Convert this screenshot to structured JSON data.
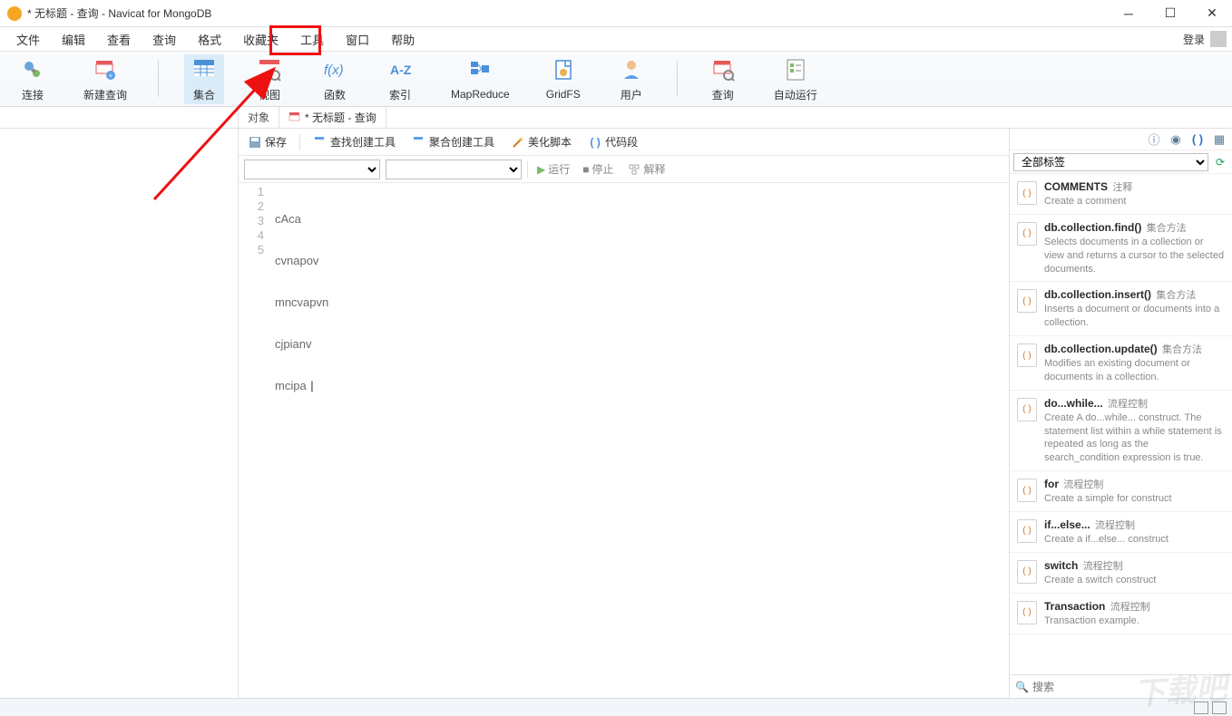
{
  "title": "* 无标题 - 查询 - Navicat for MongoDB",
  "menu": {
    "items": [
      "文件",
      "编辑",
      "查看",
      "查询",
      "格式",
      "收藏夹",
      "工具",
      "窗口",
      "帮助"
    ],
    "login": "登录"
  },
  "toolbar": [
    {
      "id": "connect",
      "label": "连接"
    },
    {
      "id": "newquery",
      "label": "新建查询"
    },
    {
      "id": "collection",
      "label": "集合",
      "active": true
    },
    {
      "id": "view",
      "label": "视图"
    },
    {
      "id": "function",
      "label": "函数"
    },
    {
      "id": "index",
      "label": "索引"
    },
    {
      "id": "mapreduce",
      "label": "MapReduce"
    },
    {
      "id": "gridfs",
      "label": "GridFS"
    },
    {
      "id": "user",
      "label": "用户"
    },
    {
      "id": "query",
      "label": "查询"
    },
    {
      "id": "autorun",
      "label": "自动运行"
    }
  ],
  "tabs": {
    "object": "对象",
    "doc": "* 无标题 - 查询"
  },
  "subtoolbar": {
    "save": "保存",
    "findbuilder": "查找创建工具",
    "aggbuilder": "聚合创建工具",
    "beautify": "美化脚本",
    "snippet": "代码段"
  },
  "querybar": {
    "run": "运行",
    "stop": "停止",
    "explain": "解释"
  },
  "editor": {
    "lines": [
      "cAca",
      "cvnapov",
      "mncvapvn",
      "cjpianv",
      "mcipa "
    ]
  },
  "rightpane": {
    "filter_label": "全部标签",
    "search_placeholder": "搜索",
    "snippets": [
      {
        "title": "COMMENTS",
        "tag": "注释",
        "desc": "Create a comment"
      },
      {
        "title": "db.collection.find()",
        "tag": "集合方法",
        "desc": "Selects documents in a collection or view and returns a cursor to the selected documents."
      },
      {
        "title": "db.collection.insert()",
        "tag": "集合方法",
        "desc": "Inserts a document or documents into a collection."
      },
      {
        "title": "db.collection.update()",
        "tag": "集合方法",
        "desc": "Modifies an existing document or documents in a collection."
      },
      {
        "title": "do...while...",
        "tag": "流程控制",
        "desc": "Create A do...while... construct. The statement list within a while statement is repeated as long as the search_condition expression is true."
      },
      {
        "title": "for",
        "tag": "流程控制",
        "desc": "Create a simple for construct"
      },
      {
        "title": "if...else...",
        "tag": "流程控制",
        "desc": "Create a if...else... construct"
      },
      {
        "title": "switch",
        "tag": "流程控制",
        "desc": "Create a switch construct"
      },
      {
        "title": "Transaction",
        "tag": "流程控制",
        "desc": "Transaction example."
      }
    ]
  },
  "watermark": "下载吧"
}
